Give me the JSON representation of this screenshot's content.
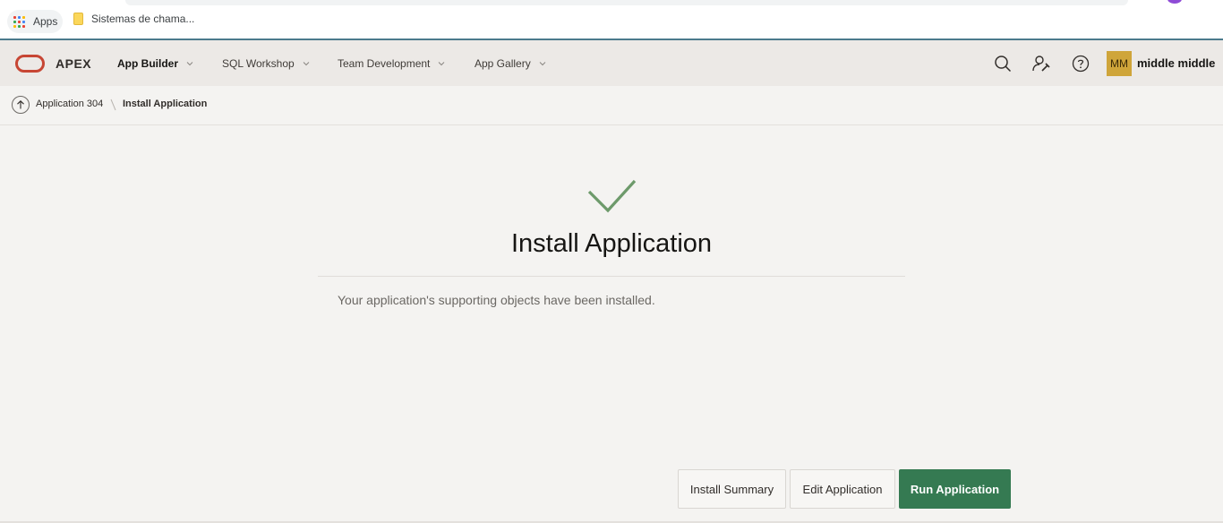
{
  "browser": {
    "bookmarks": [
      {
        "label": "Apps",
        "icon": "apps-grid-icon"
      },
      {
        "label": "Sistemas de chama..."
      }
    ]
  },
  "header": {
    "brand": "APEX",
    "nav": [
      {
        "label": "App Builder",
        "active": true
      },
      {
        "label": "SQL Workshop",
        "active": false
      },
      {
        "label": "Team Development",
        "active": false
      },
      {
        "label": "App Gallery",
        "active": false
      }
    ],
    "icons": [
      "search-icon",
      "administration-icon",
      "help-icon"
    ],
    "user": {
      "initials": "MM",
      "name": "middle middle"
    }
  },
  "breadcrumb": {
    "parent": "Application 304",
    "current": "Install Application"
  },
  "main": {
    "title": "Install Application",
    "message": "Your application's supporting objects have been installed."
  },
  "actions": {
    "install_summary": "Install Summary",
    "edit_application": "Edit Application",
    "run_application": "Run Application"
  },
  "colors": {
    "accent_green": "#357a52",
    "oracle_red": "#c74634",
    "check_green": "#6d9a6b",
    "avatar": "#cfa53a"
  }
}
